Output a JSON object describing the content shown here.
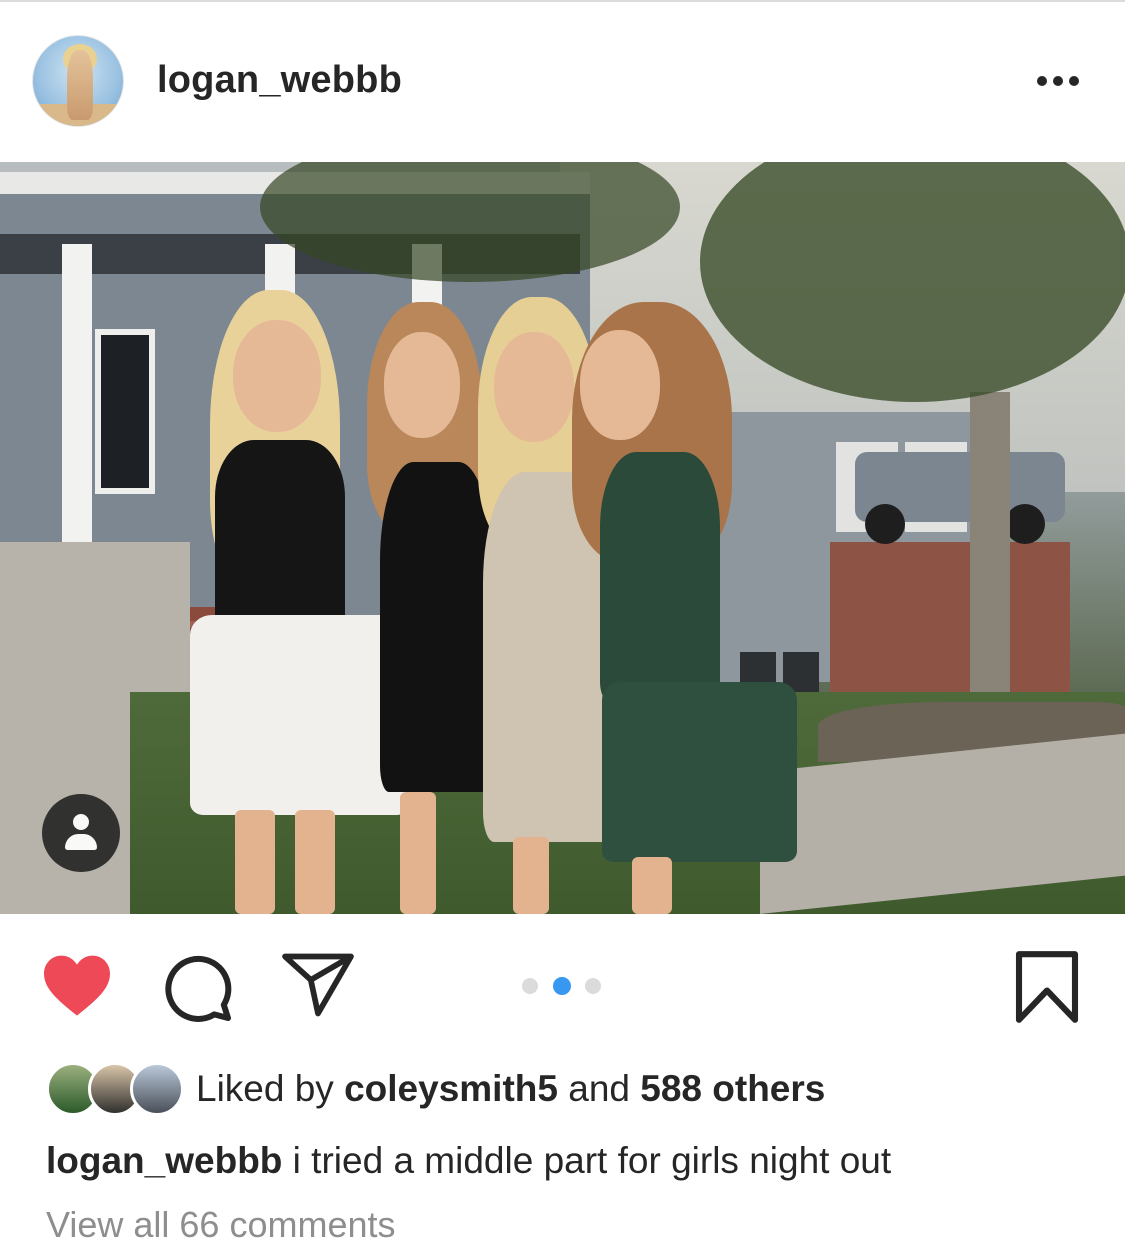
{
  "post": {
    "username": "logan_webbb",
    "more_label": "More options",
    "image_alt": "Four girls posing in dresses in front of a house",
    "carousel": {
      "count": 3,
      "active_index": 1
    }
  },
  "actions": {
    "liked": true,
    "like_color": "#ed4956",
    "icons": [
      "heart-icon",
      "comment-icon",
      "share-icon",
      "bookmark-icon"
    ]
  },
  "likes": {
    "prefix": "Liked by ",
    "user": "coleysmith5",
    "middle": " and ",
    "count": "588 others"
  },
  "caption": {
    "username": "logan_webbb",
    "text": " i tried a middle part for girls night out"
  },
  "comments": {
    "view_all": "View all 66 comments"
  },
  "colors": {
    "text": "#262626",
    "muted": "#8e8e8e",
    "accent": "#3897f0",
    "divider": "#dbdbdb"
  }
}
